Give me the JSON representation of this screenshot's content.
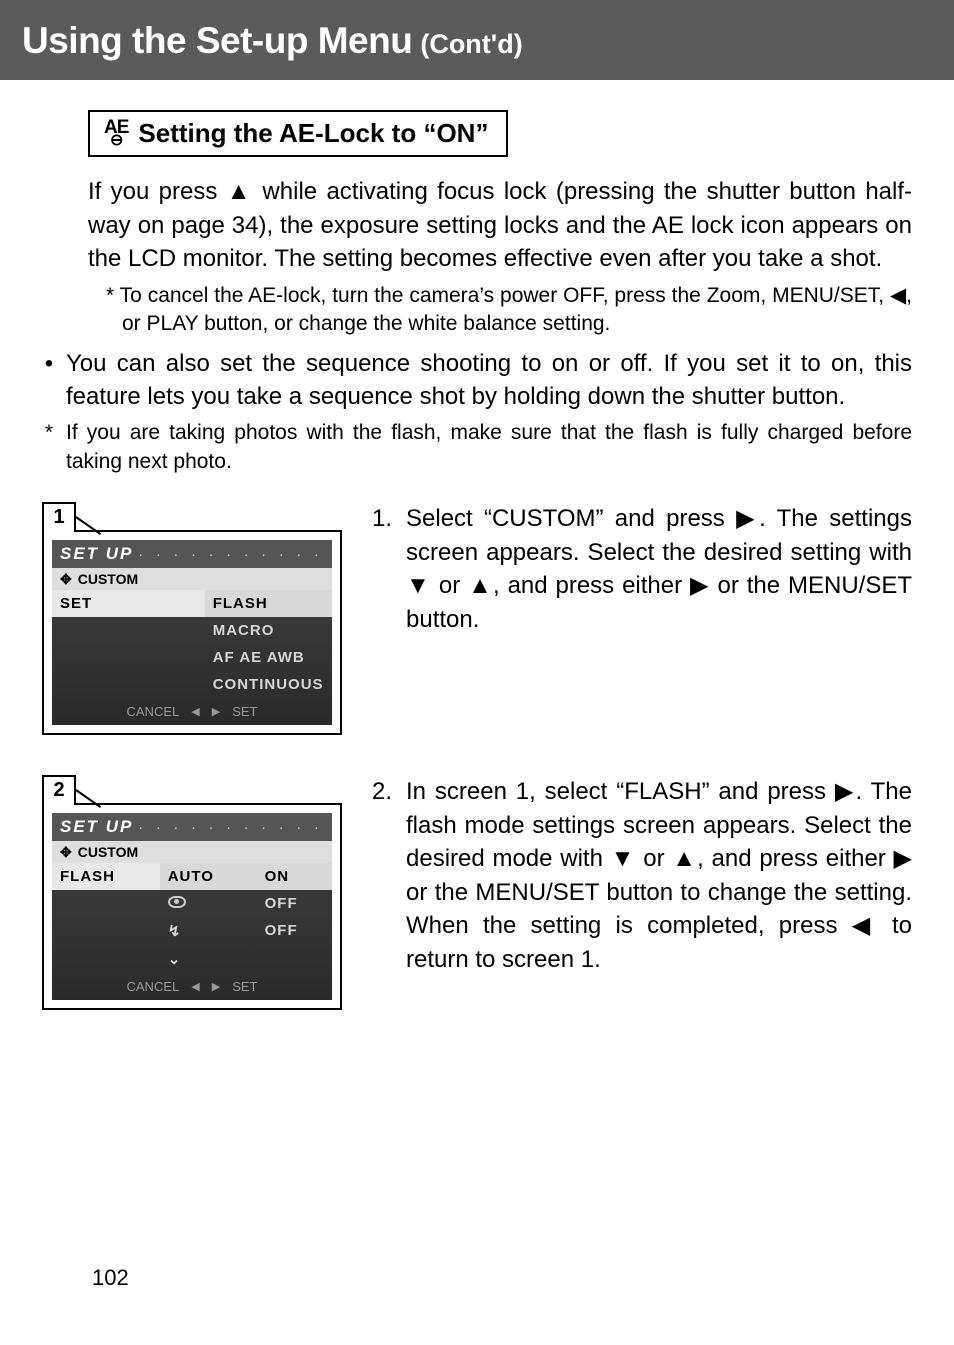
{
  "header": {
    "main": "Using the Set-up Menu",
    "sub": "(Cont'd)"
  },
  "section": {
    "ae_icon_top": "AE",
    "ae_icon_bottom": "⊖",
    "title": "Setting the AE-Lock to “ON”"
  },
  "paragraphs": {
    "p1": "If you press ▲ while activating focus lock (pressing the shutter button half-way on page 34), the exposure setting locks and the AE lock icon appears on the LCD monitor. The setting becomes effective even after you take a shot.",
    "note1": "* To cancel the AE-lock, turn the camera’s power OFF, press the Zoom, MENU/SET, ◀, or PLAY button, or change the white balance setting.",
    "bullet1": "You can also set the sequence shooting to on or off. If you set it to on, this feature lets you take a sequence shot by holding down the shutter button.",
    "star1": "If you are taking photos with the flash, make sure that the flash is fully charged before taking next photo."
  },
  "steps": {
    "s1": {
      "num": "1.",
      "text": "Select “CUSTOM” and press ▶. The settings screen appears. Select the desired setting with ▼ or ▲, and press either ▶ or the MENU/SET button."
    },
    "s2": {
      "num": "2.",
      "text": "In screen 1, select “FLASH” and press ▶. The flash mode settings screen appears. Select the desired mode with ▼ or ▲, and press either ▶ or the MENU/SET button to change the setting. When the setting is completed, press ◀ to return to screen 1."
    }
  },
  "lcd": {
    "title": "SET UP",
    "dots": ". . . . . . . . . . . . .",
    "custom": "CUSTOM",
    "footer_cancel": "CANCEL",
    "footer_set": "SET",
    "screen1": {
      "tab": "1",
      "left_col": "SET",
      "rows": [
        "FLASH",
        "MACRO",
        "AF  AE  AWB",
        "CONTINUOUS"
      ]
    },
    "screen2": {
      "tab": "2",
      "left_col": "FLASH",
      "col2": [
        "AUTO",
        "eye",
        "bolt",
        "chev"
      ],
      "col3": [
        "ON",
        "OFF",
        "OFF",
        ""
      ]
    }
  },
  "page_number": "102"
}
